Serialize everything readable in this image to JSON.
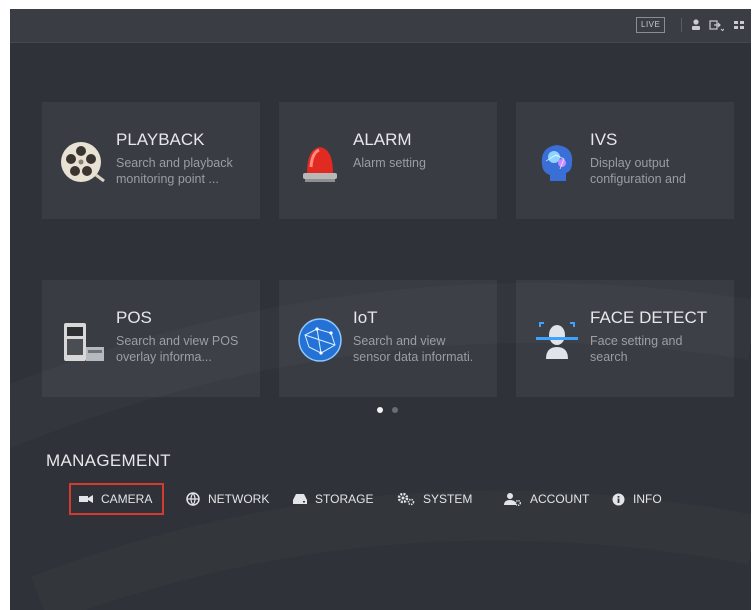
{
  "topbar": {
    "live_label": "LIVE"
  },
  "tiles": [
    {
      "title": "PLAYBACK",
      "desc": "Search and playback\nmonitoring point ..."
    },
    {
      "title": "ALARM",
      "desc": "Alarm setting"
    },
    {
      "title": "IVS",
      "desc": "Display output\nconfiguration and"
    },
    {
      "title": "POS",
      "desc": "Search and view POS\noverlay informa..."
    },
    {
      "title": "IoT",
      "desc": "Search and view\nsensor data informati."
    },
    {
      "title": "FACE DETECT",
      "desc": "Face setting and\nsearch"
    }
  ],
  "pagination": {
    "active_page": 1,
    "total_pages": 2
  },
  "management": {
    "title": "MANAGEMENT",
    "items": [
      {
        "label": "CAMERA",
        "icon": "camera-icon",
        "selected": true
      },
      {
        "label": "NETWORK",
        "icon": "network-icon"
      },
      {
        "label": "STORAGE",
        "icon": "storage-icon"
      },
      {
        "label": "SYSTEM",
        "icon": "system-gears-icon"
      },
      {
        "label": "ACCOUNT",
        "icon": "account-icon"
      },
      {
        "label": "INFO",
        "icon": "info-icon"
      }
    ]
  },
  "colors": {
    "background": "#2f3238",
    "tile": "#393c43",
    "selection": "#d43a2f"
  }
}
